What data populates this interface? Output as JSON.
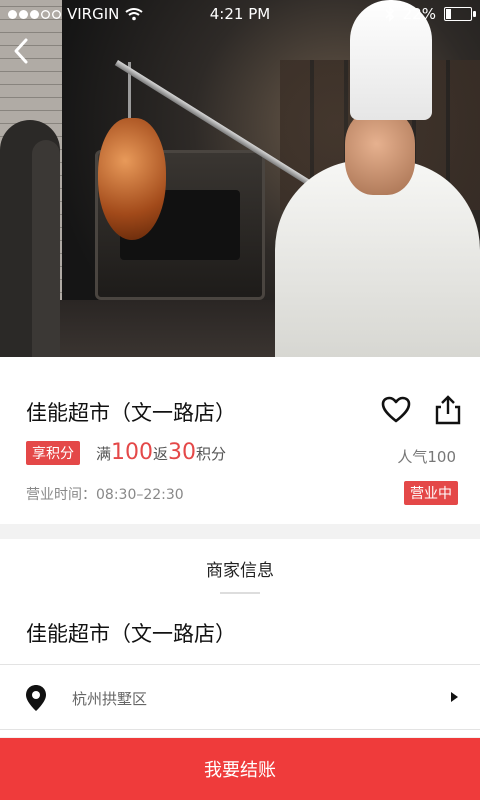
{
  "status_bar": {
    "carrier": "VIRGIN",
    "time": "4:21 PM",
    "battery_text": "22%",
    "battery_level": 0.22
  },
  "store": {
    "name": "佳能超市（文一路店）",
    "points_badge": "享积分",
    "promo": {
      "prefix": "满",
      "threshold": "100",
      "mid": "返",
      "reward": "30",
      "suffix": "积分"
    },
    "popularity": "人气100",
    "hours": "营业时间：08:30–22:30",
    "status": "营业中"
  },
  "merchant_info": {
    "section_title": "商家信息",
    "name": "佳能超市（文一路店）",
    "address": "杭州拱墅区"
  },
  "checkout": {
    "label": "我要结账"
  },
  "colors": {
    "accent": "#E44848",
    "button": "#EF3B3B"
  },
  "icons": {
    "back": "back-chevron-icon",
    "favorite": "heart-icon",
    "share": "share-icon",
    "location": "location-pin-icon",
    "arrow": "arrow-right-icon"
  }
}
